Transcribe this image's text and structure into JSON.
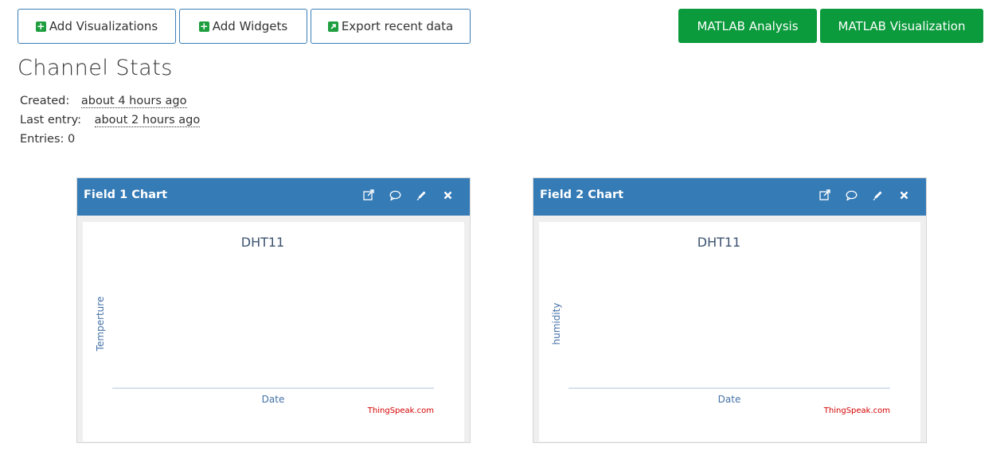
{
  "toolbar": {
    "add_visualizations": "Add Visualizations",
    "add_widgets": "Add Widgets",
    "export_recent_data": "Export recent data",
    "matlab_analysis": "MATLAB Analysis",
    "matlab_visualization": "MATLAB Visualization"
  },
  "channel_stats": {
    "title": "Channel Stats",
    "created_label": "Created:",
    "created_value": "about 4 hours ago",
    "last_entry_label": "Last entry:",
    "last_entry_value": "about 2 hours ago",
    "entries_label": "Entries:",
    "entries_value": "0"
  },
  "panels": [
    {
      "title": "Field 1 Chart",
      "icons": [
        "external-link-icon",
        "comment-icon",
        "pencil-icon",
        "close-icon"
      ]
    },
    {
      "title": "Field 2 Chart",
      "icons": [
        "external-link-icon",
        "comment-icon",
        "pencil-icon",
        "close-icon"
      ]
    }
  ],
  "chart_data": [
    {
      "type": "line",
      "title": "DHT11",
      "xlabel": "Date",
      "ylabel": "Temperture",
      "credit": "ThingSpeak.com",
      "series": [],
      "grid": false
    },
    {
      "type": "line",
      "title": "DHT11",
      "xlabel": "Date",
      "ylabel": "humidity",
      "credit": "ThingSpeak.com",
      "series": [],
      "grid": false
    }
  ],
  "colors": {
    "primary_blue": "#357bb6",
    "green": "#0b9a3c",
    "credit_red": "#d40000"
  }
}
